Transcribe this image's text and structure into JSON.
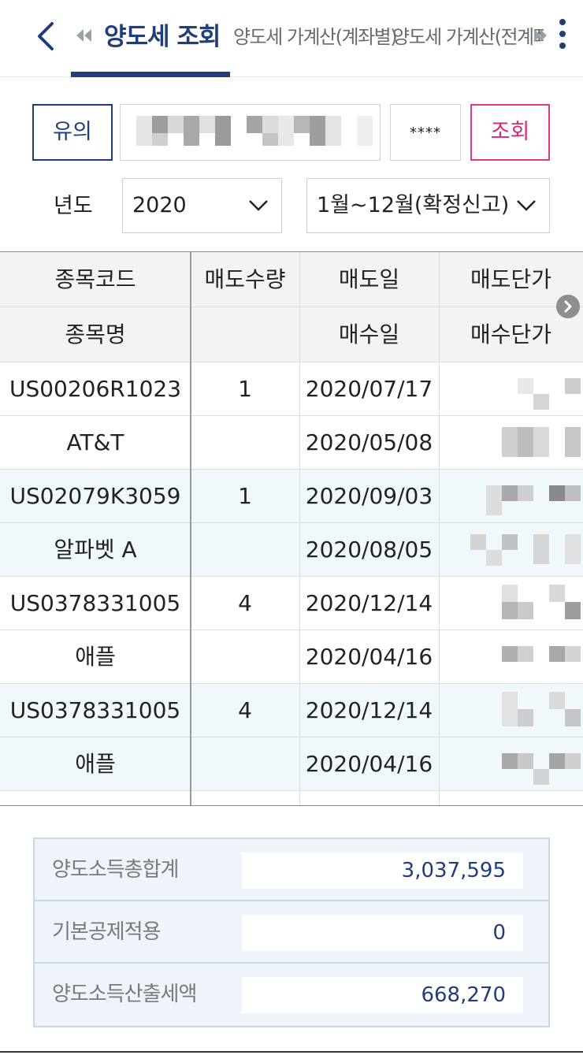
{
  "header": {
    "tabs": [
      {
        "label": "양도세 조회",
        "active": true
      },
      {
        "label": "양도세 가계산(계좌별)",
        "active": false
      },
      {
        "label": "양도세 가계산(전계좌)",
        "active": false
      }
    ],
    "icons": {
      "back": "chevron-left-icon",
      "prev": "double-chevron-left-icon",
      "next": "double-chevron-right-icon",
      "more": "kebab-menu-icon"
    }
  },
  "query": {
    "notice_label": "유의",
    "password_masked": "****",
    "query_label": "조회",
    "year_label": "년도",
    "year_value": "2020",
    "period_value": "1월~12월(확정신고)"
  },
  "table": {
    "headers_top": [
      "종목코드",
      "매도수량",
      "매도일",
      "매도단가"
    ],
    "headers_bottom": [
      "종목명",
      "",
      "매수일",
      "매수단가"
    ],
    "rows": [
      {
        "code": "US00206R1023",
        "qty": "1",
        "sell_date": "2020/07/17",
        "name": "AT&T",
        "buy_date": "2020/05/08"
      },
      {
        "code": "US02079K3059",
        "qty": "1",
        "sell_date": "2020/09/03",
        "name": "알파벳 A",
        "buy_date": "2020/08/05"
      },
      {
        "code": "US0378331005",
        "qty": "4",
        "sell_date": "2020/12/14",
        "name": "애플",
        "buy_date": "2020/04/16"
      },
      {
        "code": "US0378331005",
        "qty": "4",
        "sell_date": "2020/12/14",
        "name": "애플",
        "buy_date": "2020/04/16"
      }
    ]
  },
  "summary": {
    "total_gain_label": "양도소득총합계",
    "total_gain_value": "3,037,595",
    "deduction_label": "기본공제적용",
    "deduction_value": "0",
    "tax_label": "양도소득산출세액",
    "tax_value": "668,270"
  },
  "colors": {
    "primary": "#1f3e7a",
    "accent": "#e0388a",
    "row_alt": "#f1f8fc"
  }
}
